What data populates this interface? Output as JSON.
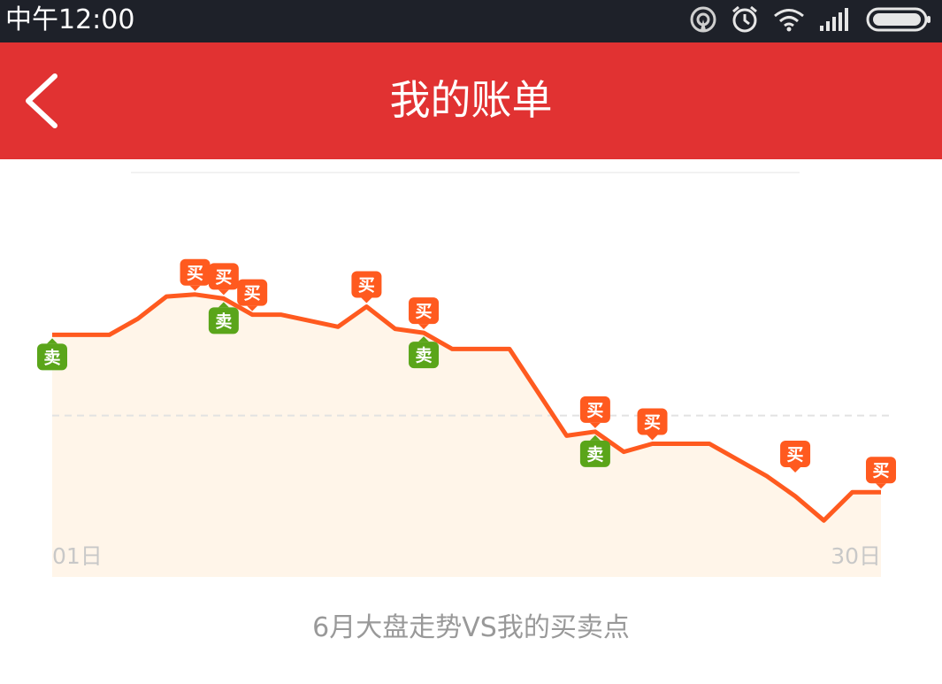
{
  "status_bar": {
    "time": "中午12:00"
  },
  "header": {
    "title": "我的账单",
    "back_icon": "chevron-left-icon"
  },
  "colors": {
    "header_bg": "#e13232",
    "status_bg": "#1e2129",
    "line": "#ff5a1f",
    "fill": "#fff5e9",
    "buy": "#ff5a1f",
    "sell": "#5aa51a",
    "caption": "#999999"
  },
  "chart_data": {
    "type": "line",
    "title": "",
    "caption": "6月大盘走势VS我的买卖点",
    "x_tick_labels": [
      "01日",
      "30日"
    ],
    "x": [
      1,
      3,
      4,
      5,
      6,
      7,
      8,
      9,
      11,
      12,
      13,
      14,
      15,
      16,
      17,
      19,
      20,
      21,
      22,
      23,
      24,
      26,
      27,
      28,
      29,
      30
    ],
    "y": [
      70,
      70,
      74,
      79.5,
      80,
      79,
      75,
      75,
      72,
      77,
      71.5,
      70.5,
      66.5,
      66.5,
      66.5,
      45,
      46,
      41,
      43,
      43,
      43,
      35,
      30,
      24,
      31,
      31
    ],
    "ylim": [
      10,
      110
    ],
    "reference_line": 50,
    "markers": [
      {
        "label": "卖",
        "type": "sell",
        "x": 1,
        "y": 70
      },
      {
        "label": "买",
        "type": "buy",
        "x": 6,
        "y": 80
      },
      {
        "label": "买",
        "type": "buy",
        "x": 7,
        "y": 79
      },
      {
        "label": "卖",
        "type": "sell",
        "x": 7,
        "y": 79
      },
      {
        "label": "买",
        "type": "buy",
        "x": 8,
        "y": 75
      },
      {
        "label": "买",
        "type": "buy",
        "x": 12,
        "y": 77
      },
      {
        "label": "买",
        "type": "buy",
        "x": 14,
        "y": 70.5
      },
      {
        "label": "卖",
        "type": "sell",
        "x": 14,
        "y": 70.5
      },
      {
        "label": "买",
        "type": "buy",
        "x": 20,
        "y": 46
      },
      {
        "label": "卖",
        "type": "sell",
        "x": 20,
        "y": 46
      },
      {
        "label": "买",
        "type": "buy",
        "x": 22,
        "y": 43
      },
      {
        "label": "买",
        "type": "buy",
        "x": 27,
        "y": 35
      },
      {
        "label": "买",
        "type": "buy",
        "x": 30,
        "y": 31
      }
    ]
  }
}
